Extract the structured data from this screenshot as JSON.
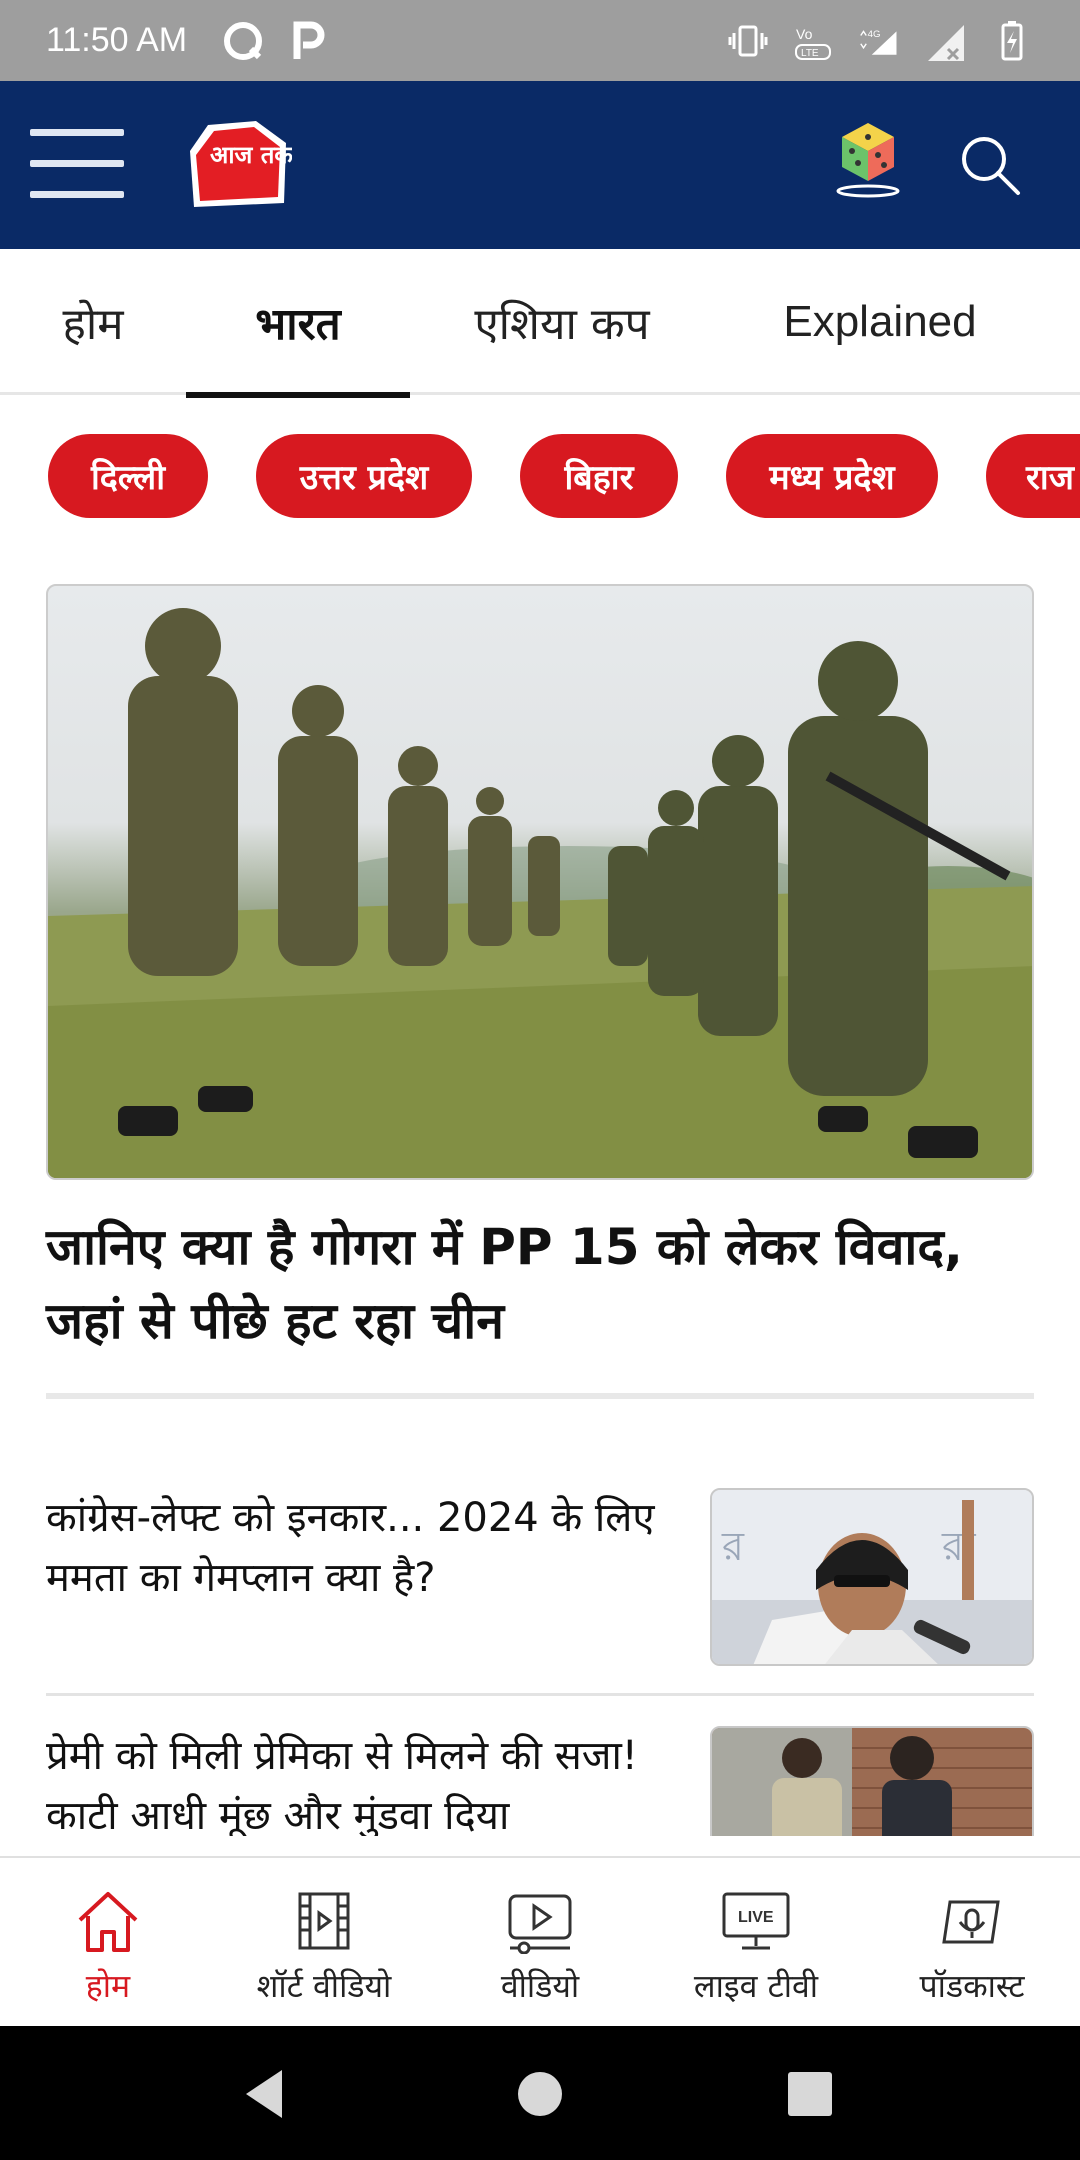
{
  "status_bar": {
    "time": "11:50 AM",
    "network": "4G",
    "volte": "VoLTE"
  },
  "header": {
    "logo_text": "आज तक",
    "menu_icon": "hamburger-icon",
    "game_icon": "dice-icon",
    "search_icon": "search-icon",
    "bg_color": "#0a2a66"
  },
  "tabs": [
    {
      "label": "होम",
      "active": false
    },
    {
      "label": "भारत",
      "active": true
    },
    {
      "label": "एशिया कप",
      "active": false
    },
    {
      "label": "Explained",
      "active": false
    }
  ],
  "chips": [
    "दिल्ली",
    "उत्तर प्रदेश",
    "बिहार",
    "मध्य प्रदेश",
    "राज"
  ],
  "hero": {
    "title": "जानिए क्या है गोगरा में PP 15 को लेकर विवाद, जहां से पीछे हट रहा चीन"
  },
  "articles": [
    {
      "title": "कांग्रेस-लेफ्ट को इनकार... 2024 के लिए ममता का गेमप्लान क्या है?"
    },
    {
      "title": "प्रेमी को मिली प्रेमिका से मिलने की सजा! काटी आधी मूंछ और मुंडवा दिया"
    }
  ],
  "bottom_nav": [
    {
      "label": "होम",
      "icon": "home-icon",
      "active": true
    },
    {
      "label": "शॉर्ट वीडियो",
      "icon": "film-icon",
      "active": false
    },
    {
      "label": "वीडियो",
      "icon": "video-play-icon",
      "active": false
    },
    {
      "label": "लाइव टीवी",
      "icon": "live-tv-icon",
      "active": false
    },
    {
      "label": "पॉडकास्ट",
      "icon": "podcast-icon",
      "active": false
    }
  ],
  "live_badge": "LIVE",
  "accent_color": "#d71920"
}
